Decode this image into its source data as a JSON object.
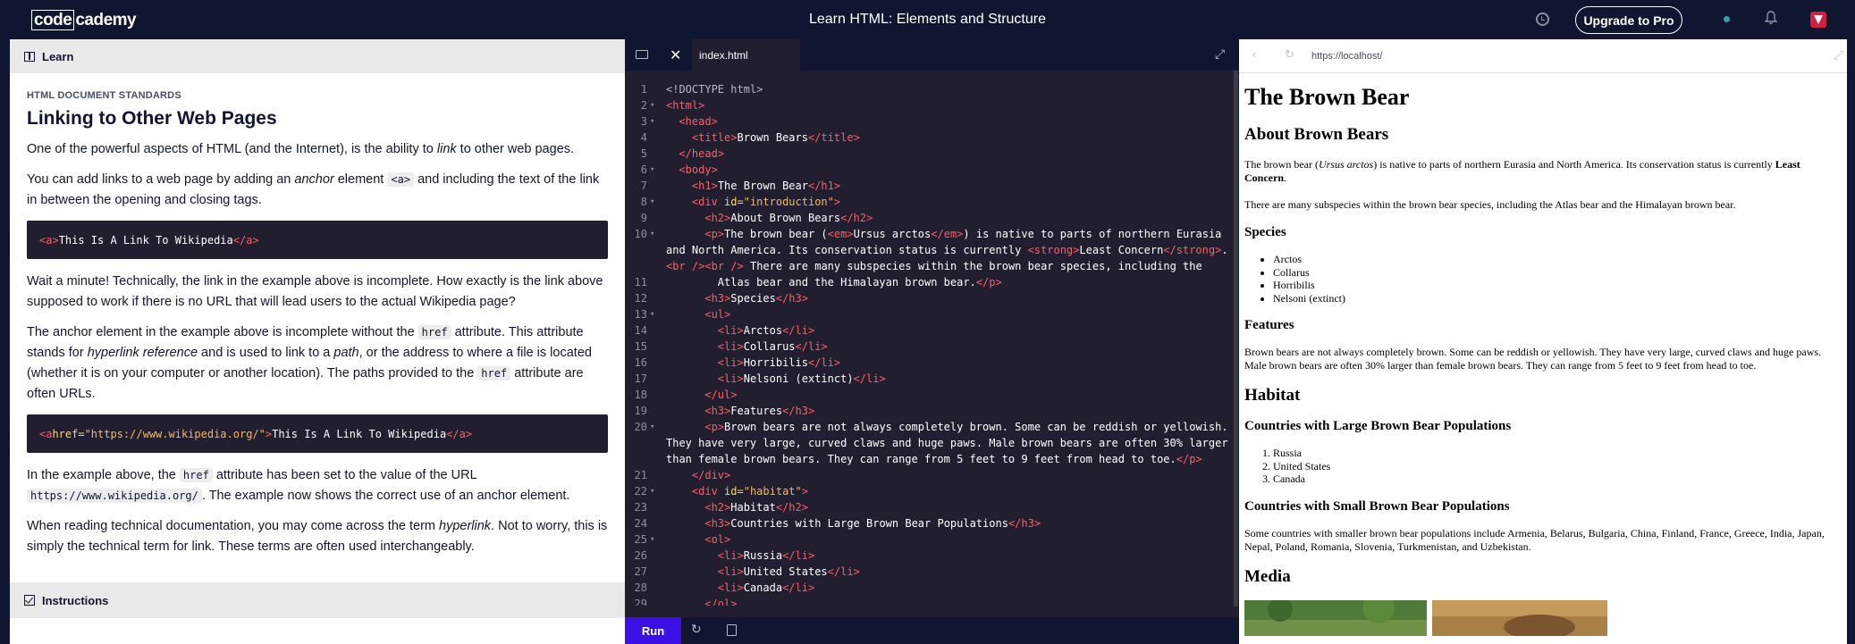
{
  "topbar": {
    "logo_box": "code",
    "logo_rest": "cademy",
    "title": "Learn HTML: Elements and Structure",
    "upgrade": "Upgrade to Pro"
  },
  "learn": {
    "header": "Learn",
    "kicker": "HTML DOCUMENT STANDARDS",
    "title": "Linking to Other Web Pages",
    "p1a": "One of the powerful aspects of HTML (and the Internet), is the ability to ",
    "p1em": "link",
    "p1b": " to other web pages.",
    "p2a": "You can add links to a web page by adding an ",
    "p2em": "anchor",
    "p2b": " element ",
    "p2code": "<a>",
    "p2c": " and including the text of the link in between the opening and closing tags.",
    "ex1_open": "<a>",
    "ex1_text": "This Is A Link To Wikipedia",
    "ex1_close": "</a>",
    "p3": "Wait a minute! Technically, the link in the example above is incomplete. How exactly is the link above supposed to work if there is no URL that will lead users to the actual Wikipedia page?",
    "p4a": "The anchor element in the example above is incomplete without the ",
    "p4code": "href",
    "p4b": " attribute. This attribute stands for ",
    "p4em": "hyperlink reference",
    "p4c": " and is used to link to a ",
    "p4em2": "path",
    "p4d": ", or the address to where a file is located (whether it is on your computer or another location). The paths provided to the ",
    "p4code2": "href",
    "p4e": " attribute are often URLs.",
    "ex2_open": "<a ",
    "ex2_attr": "href=",
    "ex2_str": "\"https://www.wikipedia.org/\"",
    "ex2_gt": ">",
    "ex2_text": "This Is A Link To Wikipedia",
    "ex2_close": "</a>",
    "p5a": "In the example above, the ",
    "p5code": "href",
    "p5b": " attribute has been set to the value of the URL ",
    "p5code2": "https://www.wikipedia.org/",
    "p5c": ". The example now shows the correct use of an anchor element.",
    "p6a": "When reading technical documentation, you may come across the term ",
    "p6em": "hyperlink",
    "p6b": ". Not to worry, this is simply the technical term for link. These terms are often used interchangeably.",
    "instructions": "Instructions"
  },
  "editor": {
    "file": "index.html",
    "run": "Run",
    "lines": [
      {
        "n": "1",
        "fold": false,
        "t": "<!DOCTYPE html>"
      },
      {
        "n": "2",
        "fold": true,
        "t": "<html>"
      },
      {
        "n": "3",
        "fold": true,
        "t": "  <head>"
      },
      {
        "n": "4",
        "fold": false,
        "t": "    <title>Brown Bears</title>"
      },
      {
        "n": "5",
        "fold": false,
        "t": "  </head>"
      },
      {
        "n": "6",
        "fold": true,
        "t": "  <body>"
      },
      {
        "n": "7",
        "fold": false,
        "t": "    <h1>The Brown Bear</h1>"
      },
      {
        "n": "8",
        "fold": true,
        "t": "    <div id=\"introduction\">"
      },
      {
        "n": "9",
        "fold": false,
        "t": "      <h2>About Brown Bears</h2>"
      },
      {
        "n": "10",
        "fold": true,
        "t": "      <p>The brown bear (<em>Ursus arctos</em>) is native to parts of northern Eurasia and North America. Its conservation status is currently <strong>Least Concern</strong>.<br /><br /> There are many subspecies within the brown bear species, including the"
      },
      {
        "n": "11",
        "fold": false,
        "t": "        Atlas bear and the Himalayan brown bear.</p>"
      },
      {
        "n": "12",
        "fold": false,
        "t": "      <h3>Species</h3>"
      },
      {
        "n": "13",
        "fold": true,
        "t": "      <ul>"
      },
      {
        "n": "14",
        "fold": false,
        "t": "        <li>Arctos</li>"
      },
      {
        "n": "15",
        "fold": false,
        "t": "        <li>Collarus</li>"
      },
      {
        "n": "16",
        "fold": false,
        "t": "        <li>Horribilis</li>"
      },
      {
        "n": "17",
        "fold": false,
        "t": "        <li>Nelsoni (extinct)</li>"
      },
      {
        "n": "18",
        "fold": false,
        "t": "      </ul>"
      },
      {
        "n": "19",
        "fold": false,
        "t": "      <h3>Features</h3>"
      },
      {
        "n": "20",
        "fold": true,
        "t": "      <p>Brown bears are not always completely brown. Some can be reddish or yellowish. They have very large, curved claws and huge paws. Male brown bears are often 30% larger than female brown bears. They can range from 5 feet to 9 feet from head to toe.</p>"
      },
      {
        "n": "21",
        "fold": false,
        "t": "    </div>"
      },
      {
        "n": "22",
        "fold": true,
        "t": "    <div id=\"habitat\">"
      },
      {
        "n": "23",
        "fold": false,
        "t": "      <h2>Habitat</h2>"
      },
      {
        "n": "24",
        "fold": false,
        "t": "      <h3>Countries with Large Brown Bear Populations</h3>"
      },
      {
        "n": "25",
        "fold": true,
        "t": "      <ol>"
      },
      {
        "n": "26",
        "fold": false,
        "t": "        <li>Russia</li>"
      },
      {
        "n": "27",
        "fold": false,
        "t": "        <li>United States</li>"
      },
      {
        "n": "28",
        "fold": false,
        "t": "        <li>Canada</li>"
      },
      {
        "n": "29",
        "fold": false,
        "t": "      </ol>"
      }
    ]
  },
  "browser": {
    "url": "https://localhost/",
    "h1": "The Brown Bear",
    "about": "About Brown Bears",
    "intro_a": "The brown bear (",
    "intro_em": "Ursus arctos",
    "intro_b": ") is native to parts of northern Eurasia and North America. Its conservation status is currently ",
    "intro_strong": "Least Concern",
    "intro_c": ".",
    "intro2": "There are many subspecies within the brown bear species, including the Atlas bear and the Himalayan brown bear.",
    "species": "Species",
    "species_list": [
      "Arctos",
      "Collarus",
      "Horribilis",
      "Nelsoni (extinct)"
    ],
    "features": "Features",
    "features_text": "Brown bears are not always completely brown. Some can be reddish or yellowish. They have very large, curved claws and huge paws. Male brown bears are often 30% larger than female brown bears. They can range from 5 feet to 9 feet from head to toe.",
    "habitat": "Habitat",
    "large_pop": "Countries with Large Brown Bear Populations",
    "large_list": [
      "Russia",
      "United States",
      "Canada"
    ],
    "small_pop": "Countries with Small Brown Bear Populations",
    "small_text": "Some countries with smaller brown bear populations include Armenia, Belarus, Bulgaria, China, Finland, France, Greece, India, Japan, Nepal, Poland, Romania, Slovenia, Turkmenistan, and Uzbekistan.",
    "media": "Media"
  }
}
